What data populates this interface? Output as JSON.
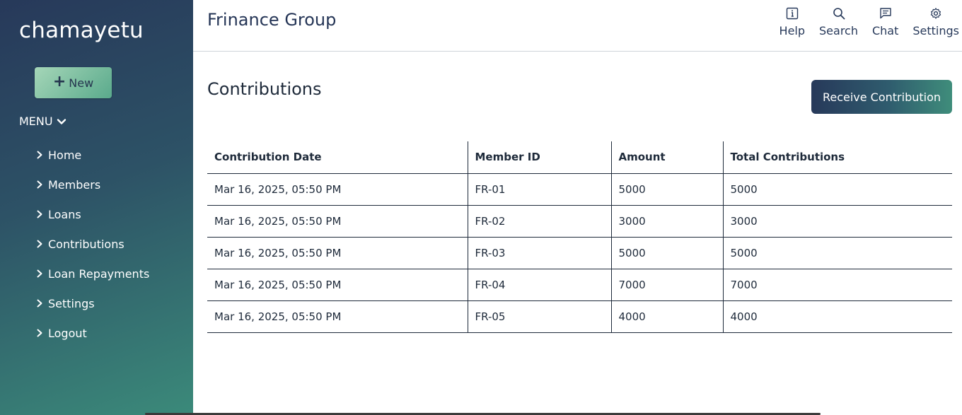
{
  "sidebar": {
    "brand": "chamayetu",
    "new_button": "New",
    "menu_label": "MENU",
    "items": [
      {
        "label": "Home"
      },
      {
        "label": "Members"
      },
      {
        "label": "Loans"
      },
      {
        "label": "Contributions"
      },
      {
        "label": "Loan Repayments"
      },
      {
        "label": "Settings"
      },
      {
        "label": "Logout"
      }
    ]
  },
  "header": {
    "group_name": "Frinance Group",
    "tools": [
      {
        "label": "Help",
        "icon": "info-icon"
      },
      {
        "label": "Search",
        "icon": "search-icon"
      },
      {
        "label": "Chat",
        "icon": "chat-icon"
      },
      {
        "label": "Settings",
        "icon": "gear-icon"
      }
    ]
  },
  "main": {
    "title": "Contributions",
    "receive_button": "Receive Contribution",
    "table": {
      "columns": [
        "Contribution Date",
        "Member ID",
        "Amount",
        "Total Contributions"
      ],
      "rows": [
        [
          "Mar 16, 2025, 05:50 PM",
          "FR-01",
          "5000",
          "5000"
        ],
        [
          "Mar 16, 2025, 05:50 PM",
          "FR-02",
          "3000",
          "3000"
        ],
        [
          "Mar 16, 2025, 05:50 PM",
          "FR-03",
          "5000",
          "5000"
        ],
        [
          "Mar 16, 2025, 05:50 PM",
          "FR-04",
          "7000",
          "7000"
        ],
        [
          "Mar 16, 2025, 05:50 PM",
          "FR-05",
          "4000",
          "4000"
        ]
      ]
    }
  },
  "colors": {
    "sidebar_top": "#27395a",
    "sidebar_bottom": "#3b8a7a",
    "accent_navy": "#253556",
    "accent_green": "#5aaa8c"
  }
}
